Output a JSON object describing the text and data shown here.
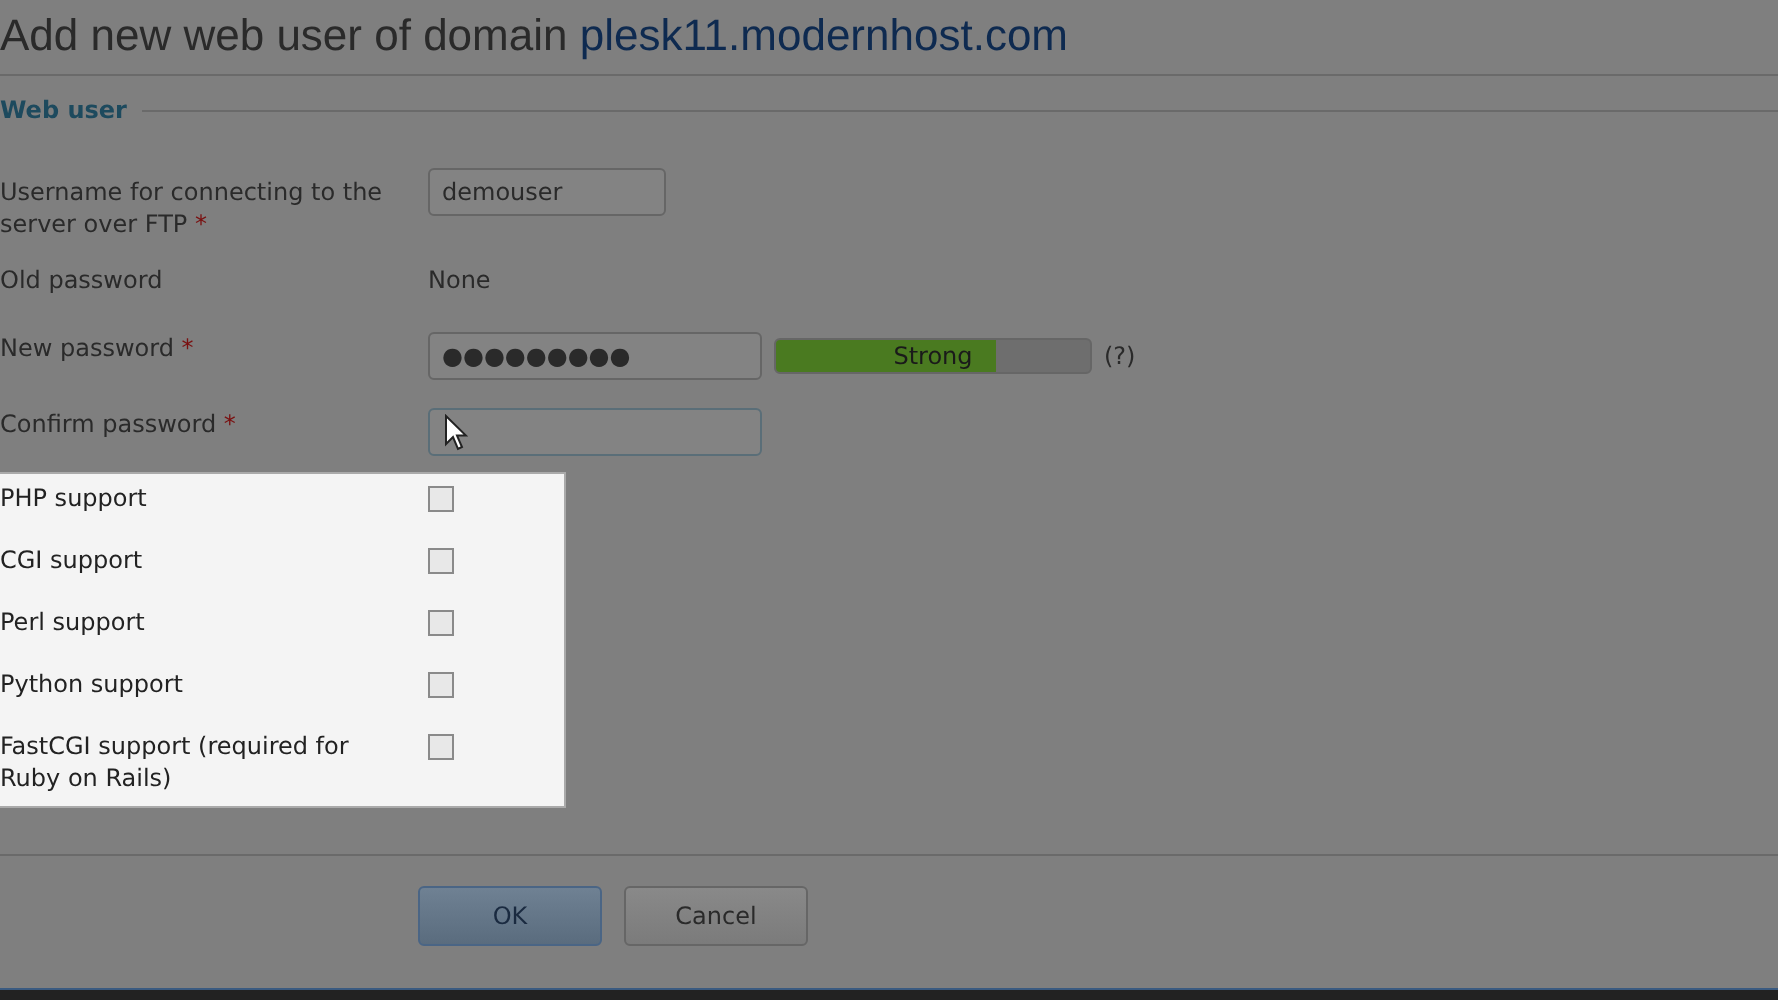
{
  "title": {
    "prefix": "Add new web user of domain",
    "domain": "plesk11.modernhost.com"
  },
  "section": "Web user",
  "fields": [
    {
      "kind": "text",
      "label": "Username for connecting to the server over FTP",
      "required_mark": "*",
      "value": "demouser"
    },
    {
      "kind": "static",
      "label": "Old password",
      "value": "None"
    },
    {
      "kind": "password",
      "label": "New password",
      "required_mark": "*",
      "value": "●●●●●●●●●",
      "strength": {
        "label": "Strong",
        "level": 0.7
      },
      "help": "(?)"
    },
    {
      "kind": "password",
      "label": "Confirm password",
      "required_mark": "*",
      "focused": true
    }
  ],
  "options": [
    {
      "label": "PHP support",
      "checked": false
    },
    {
      "label": "CGI support",
      "checked": false
    },
    {
      "label": "Perl support",
      "checked": false
    },
    {
      "label": "Python support",
      "checked": false
    },
    {
      "label": "FastCGI support (required for Ruby on Rails)",
      "checked": false
    }
  ],
  "buttons": [
    {
      "label": "OK",
      "kind": "primary"
    },
    {
      "label": "Cancel",
      "kind": "secondary"
    }
  ]
}
